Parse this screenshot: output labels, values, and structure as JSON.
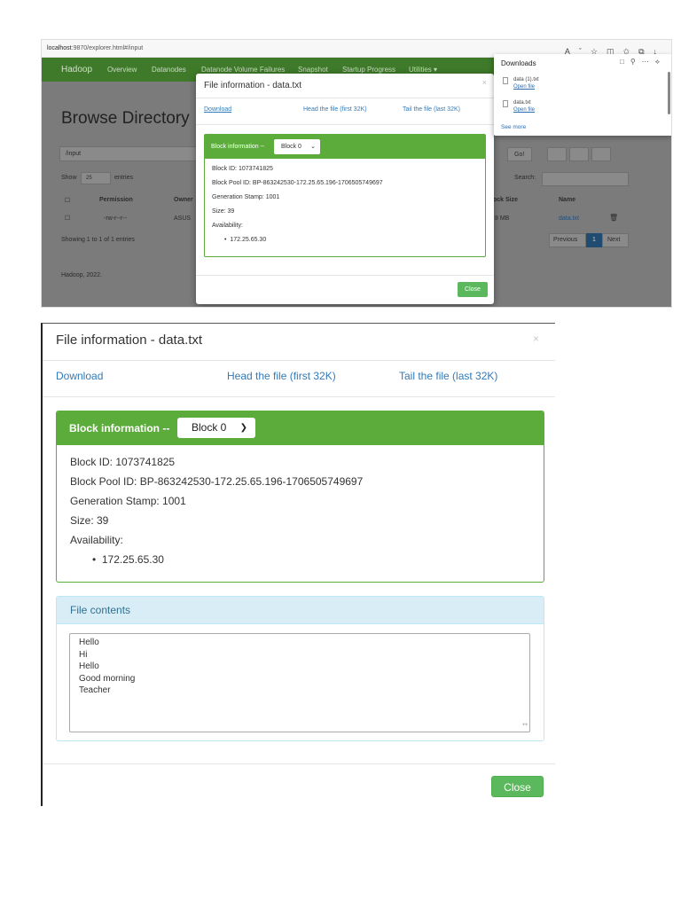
{
  "browser": {
    "url_host": "localhost",
    "url_rest": ":9870/explorer.html#/input",
    "icons": [
      "read-aloud-icon",
      "favorite-icon",
      "split-screen-icon",
      "favorites-icon",
      "collections-icon",
      "downloads-icon"
    ]
  },
  "hadoop": {
    "brand": "Hadoop",
    "nav": [
      "Overview",
      "Datanodes",
      "Datanode Volume Failures",
      "Snapshot",
      "Startup Progress",
      "Utilities ▾"
    ],
    "page_title": "Browse Directory",
    "path_value": "/input",
    "go_label": "Go!",
    "show_label": "Show",
    "entries_value": "25",
    "entries_label": "entries",
    "search_label": "Search:",
    "columns": [
      "Permission",
      "Owner",
      "ock Size",
      "Name"
    ],
    "row": {
      "permission": "-rw-r--r--",
      "owner": "ASUS",
      "block_size": "8 MB",
      "name": "data.txt"
    },
    "showing": "Showing 1 to 1 of 1 entries",
    "pager": {
      "prev": "Previous",
      "current": "1",
      "next": "Next"
    },
    "footer": "Hadoop, 2022."
  },
  "downloads": {
    "header": "Downloads",
    "items": [
      {
        "name": "data (1).txt",
        "action": "Open file"
      },
      {
        "name": "data.txt",
        "action": "Open file"
      }
    ],
    "see_more": "See more"
  },
  "modal": {
    "title": "File information - data.txt",
    "close_x": "×",
    "links": {
      "download": "Download",
      "head": "Head the file (first 32K)",
      "tail": "Tail the file (last 32K)"
    },
    "block_label": "Block information --",
    "block_selected": "Block 0",
    "block_id": "Block ID: 1073741825",
    "block_pool_id": "Block Pool ID: BP-863242530-172.25.65.196-1706505749697",
    "generation_stamp": "Generation Stamp: 1001",
    "size": "Size: 39",
    "availability_label": "Availability:",
    "availability": [
      "172.25.65.30"
    ],
    "file_contents_label": "File contents",
    "file_contents": "Hello\nHi\nHello\nGood morning\nTeacher",
    "close_label": "Close"
  },
  "colors": {
    "green": "#5cac3c",
    "nav_green": "#3e7a2a",
    "link": "#337ab7",
    "info_bg": "#d9edf7",
    "btn_green": "#5cb85c"
  }
}
